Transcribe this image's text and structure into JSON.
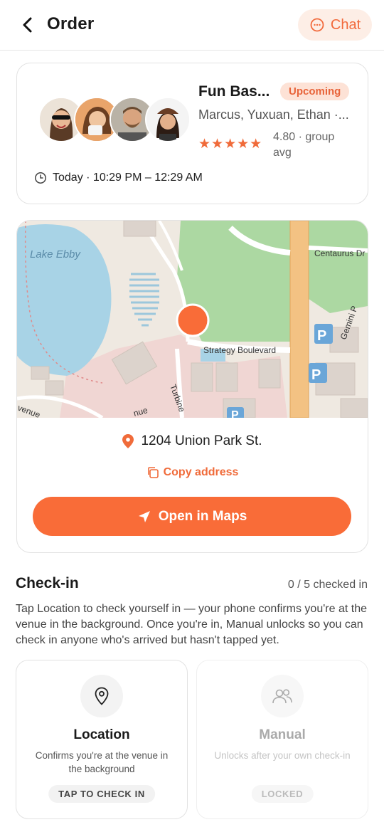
{
  "header": {
    "title": "Order",
    "chat_label": "Chat"
  },
  "order": {
    "group_name": "Fun Bas...",
    "status_badge": "Upcoming",
    "members": "Marcus, Yuxuan, Ethan ·...",
    "stars": "★★★★★",
    "rating_text": "4.80 · group avg",
    "time": "Today · 10:29 PM – 12:29 AM"
  },
  "map": {
    "labels": {
      "lake": "Lake Ebby",
      "road1": "Strategy Boulevard",
      "road2": "Centaurus Dr",
      "road3": "Turbine",
      "road4": "Gemini P",
      "road5": "venue",
      "road6": "nue"
    }
  },
  "location": {
    "address": "1204 Union Park St.",
    "copy_label": "Copy address",
    "open_maps_label": "Open in Maps"
  },
  "checkin": {
    "title": "Check-in",
    "count": "0 / 5 checked in",
    "description": "Tap Location to check yourself in — your phone confirms you're at the venue in the background. Once you're in, Manual unlocks so you can check in anyone who's arrived but hasn't tapped yet.",
    "options": [
      {
        "name": "Location",
        "subtitle": "Confirms you're at the venue in the background",
        "tag": "TAP TO CHECK IN",
        "icon": "map-pin-icon"
      },
      {
        "name": "Manual",
        "subtitle": "Unlocks after your own check-in",
        "tag": "LOCKED",
        "icon": "users-icon"
      }
    ]
  },
  "colors": {
    "accent": "#f96c38",
    "badge_bg": "#fde2d6",
    "map_water": "#a8d3e6",
    "map_park": "#a9d6a0"
  }
}
